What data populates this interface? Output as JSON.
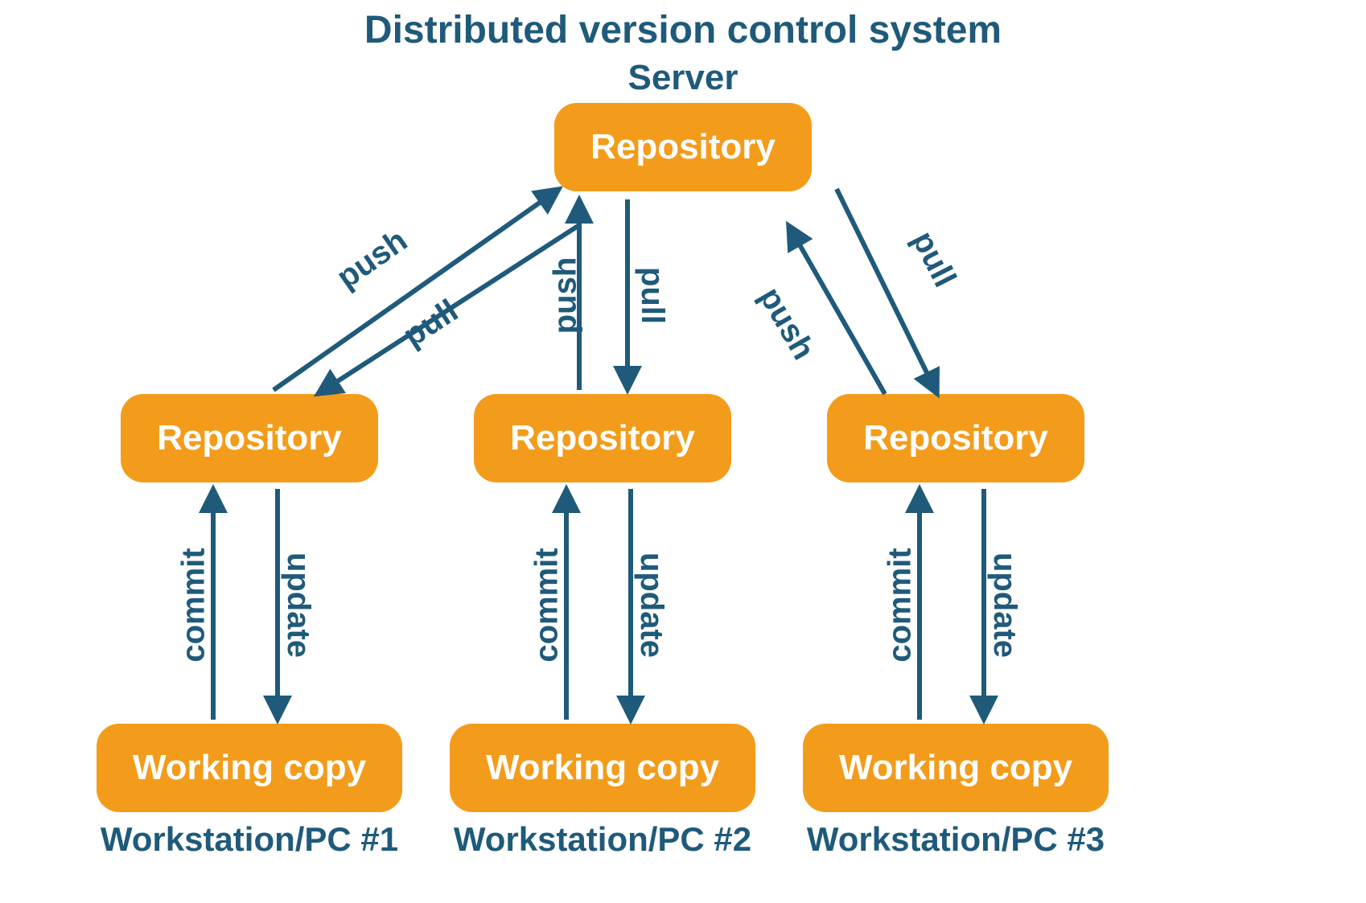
{
  "title": "Distributed version control system",
  "server_label": "Server",
  "colors": {
    "node_bg": "#f39c1b",
    "node_text": "#ffffff",
    "line": "#1f5a7a",
    "text": "#1f5a7a"
  },
  "nodes": {
    "server_repo": "Repository",
    "ws1_repo": "Repository",
    "ws2_repo": "Repository",
    "ws3_repo": "Repository",
    "ws1_working": "Working copy",
    "ws2_working": "Working copy",
    "ws3_working": "Working copy"
  },
  "workstations": {
    "ws1": "Workstation/PC #1",
    "ws2": "Workstation/PC #2",
    "ws3": "Workstation/PC #3"
  },
  "edges": {
    "ws1_push": "push",
    "ws1_pull": "pull",
    "ws2_push": "push",
    "ws2_pull": "pull",
    "ws3_push": "push",
    "ws3_pull": "pull",
    "ws1_commit": "commit",
    "ws1_update": "update",
    "ws2_commit": "commit",
    "ws2_update": "update",
    "ws3_commit": "commit",
    "ws3_update": "update"
  }
}
